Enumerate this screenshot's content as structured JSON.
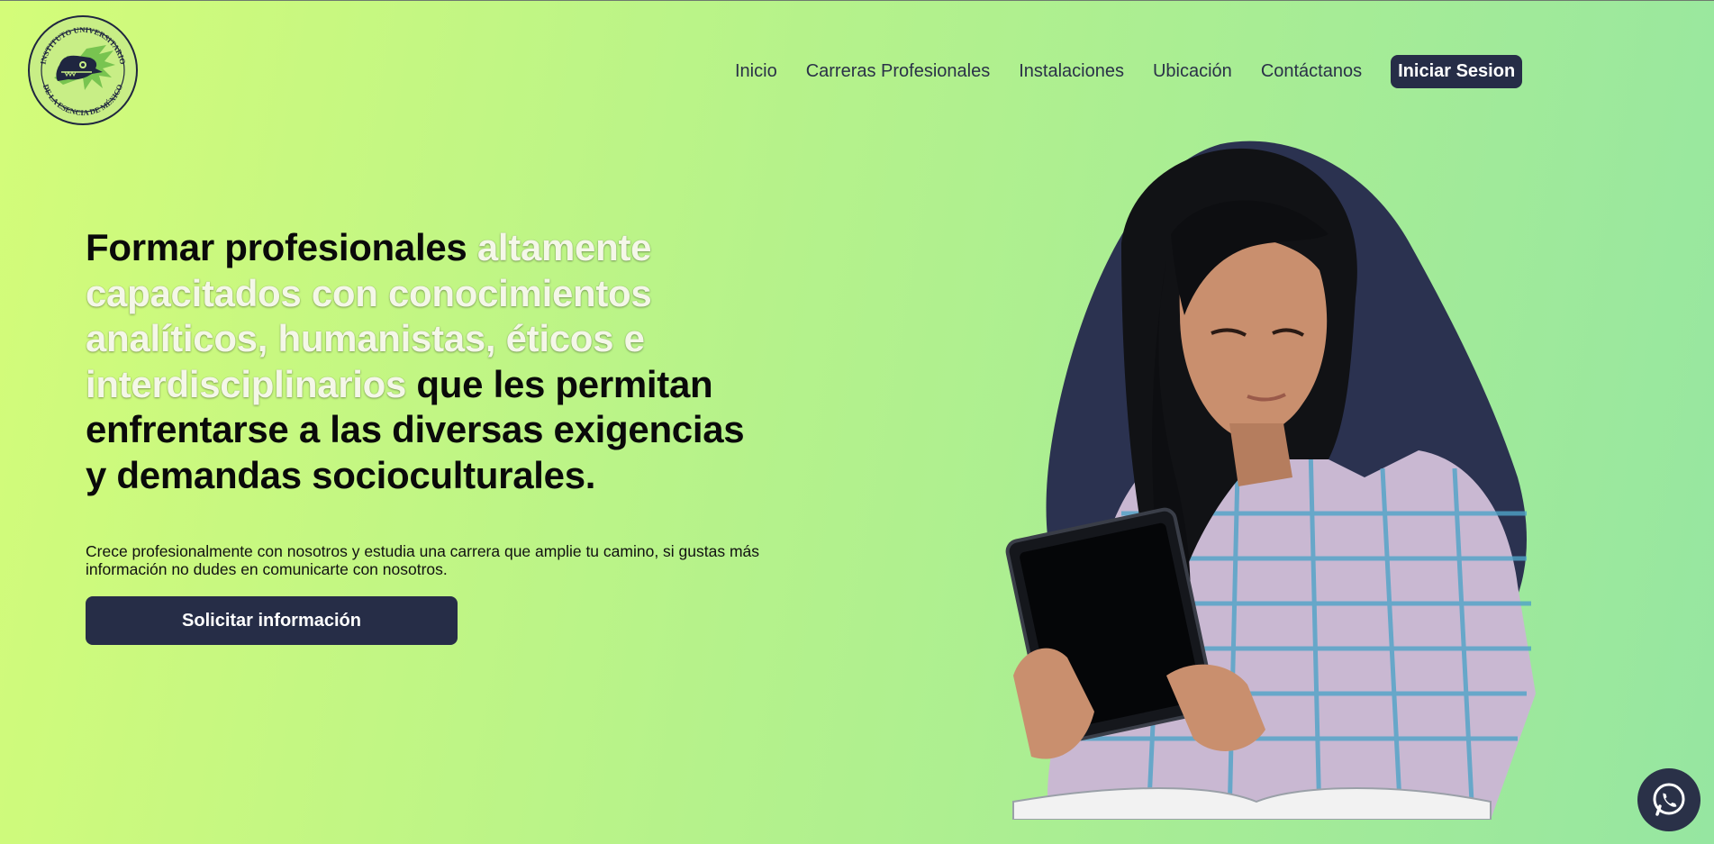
{
  "logo": {
    "text_top": "INSTITUTO UNIVERSITARIO",
    "text_bottom": "DE LA ESENCIA DE MÉXICO",
    "icon": "serpent-head-logo"
  },
  "nav": {
    "items": [
      {
        "label": "Inicio"
      },
      {
        "label": "Carreras Profesionales"
      },
      {
        "label": "Instalaciones"
      },
      {
        "label": "Ubicación"
      },
      {
        "label": "Contáctanos"
      }
    ],
    "cta_label": "Iniciar Sesion"
  },
  "hero": {
    "headline_part1": "Formar profesionales ",
    "headline_highlight": "altamente capacitados con conocimientos analíticos, humanistas, éticos e interdisciplinarios",
    "headline_part2": " que les permitan enfrentarse a las diversas exigencias y demandas socioculturales.",
    "subtitle": "Crece profesionalmente con nosotros y estudia una carrera que amplie tu camino, si gustas más información no dudes en comunicarte con nosotros.",
    "button_label": "Solicitar información"
  },
  "floating": {
    "icon": "whatsapp-icon"
  },
  "colors": {
    "bg_start": "#d4fc79",
    "bg_end": "#96e6a1",
    "navy": "#262d47",
    "highlight_text": "#f4f7e8"
  }
}
